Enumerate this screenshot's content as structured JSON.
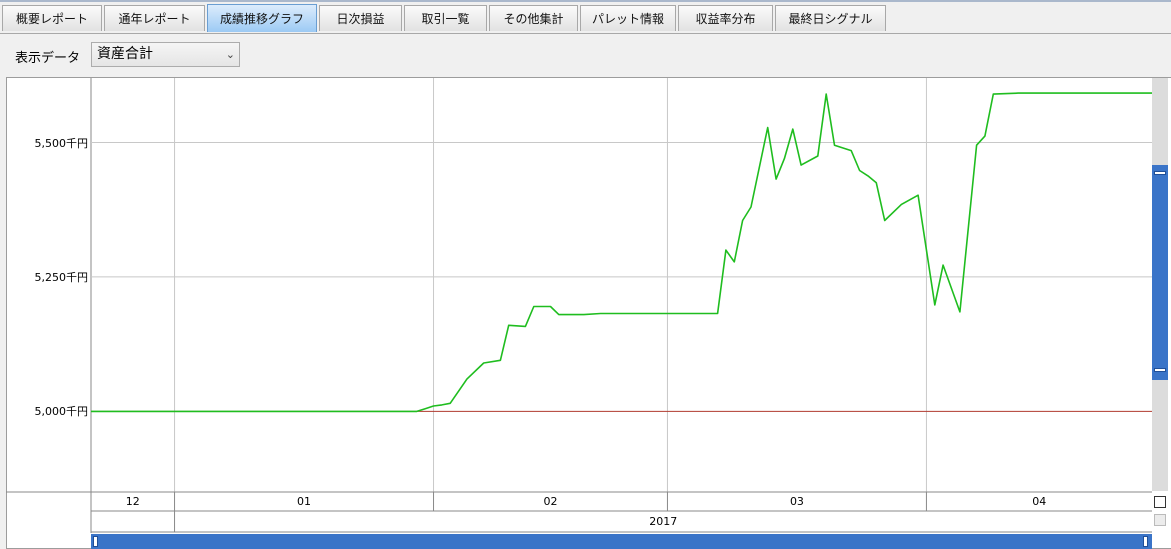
{
  "tabs": [
    {
      "label": "概要レポート"
    },
    {
      "label": "通年レポート"
    },
    {
      "label": "成績推移グラフ",
      "active": true
    },
    {
      "label": "日次損益"
    },
    {
      "label": "取引一覧"
    },
    {
      "label": "その他集計"
    },
    {
      "label": "パレット情報"
    },
    {
      "label": "収益率分布"
    },
    {
      "label": "最終日シグナル"
    }
  ],
  "selector": {
    "label": "表示データ",
    "value": "資産合計"
  },
  "colors": {
    "line": "#1fbd1f",
    "baseline": "#b03a2e",
    "accent": "#3a74c8"
  },
  "icons": [
    "chevron-down-icon"
  ],
  "chart_data": {
    "type": "line",
    "y_unit_suffix": "千円",
    "ylim": [
      4850,
      5620
    ],
    "yticks": [
      5000,
      5250,
      5500
    ],
    "ytick_labels": [
      "5,000千円",
      "5,250千円",
      "5,500千円"
    ],
    "xlim": [
      "2016-12-22",
      "2017-04-28"
    ],
    "month_labels": [
      {
        "label": "12",
        "start": "2016-12-22",
        "end": "2017-01-01"
      },
      {
        "label": "01",
        "start": "2017-01-01",
        "end": "2017-02-01"
      },
      {
        "label": "02",
        "start": "2017-02-01",
        "end": "2017-03-01"
      },
      {
        "label": "03",
        "start": "2017-03-01",
        "end": "2017-04-01"
      },
      {
        "label": "04",
        "start": "2017-04-01",
        "end": "2017-04-28"
      }
    ],
    "year_label": "2017",
    "baseline": 5000,
    "grid": true,
    "x": [
      "2016-12-22",
      "2017-01-30",
      "2017-01-31",
      "2017-02-01",
      "2017-02-02",
      "2017-02-03",
      "2017-02-05",
      "2017-02-07",
      "2017-02-09",
      "2017-02-10",
      "2017-02-12",
      "2017-02-13",
      "2017-02-15",
      "2017-02-16",
      "2017-02-17",
      "2017-02-19",
      "2017-02-21",
      "2017-02-28",
      "2017-03-07",
      "2017-03-08",
      "2017-03-09",
      "2017-03-10",
      "2017-03-11",
      "2017-03-13",
      "2017-03-14",
      "2017-03-15",
      "2017-03-16",
      "2017-03-17",
      "2017-03-19",
      "2017-03-20",
      "2017-03-21",
      "2017-03-23",
      "2017-03-24",
      "2017-03-25",
      "2017-03-26",
      "2017-03-27",
      "2017-03-29",
      "2017-03-31",
      "2017-04-02",
      "2017-04-03",
      "2017-04-05",
      "2017-04-07",
      "2017-04-08",
      "2017-04-09",
      "2017-04-12",
      "2017-04-14",
      "2017-04-15",
      "2017-04-17",
      "2017-04-18",
      "2017-04-20",
      "2017-04-22",
      "2017-04-23",
      "2017-04-24",
      "2017-04-25",
      "2017-04-26",
      "2017-04-28"
    ],
    "y": [
      5000,
      5000,
      5005,
      5010,
      5012,
      5015,
      5060,
      5090,
      5095,
      5160,
      5158,
      5195,
      5195,
      5180,
      5180,
      5180,
      5182,
      5182,
      5182,
      5300,
      5278,
      5355,
      5380,
      5528,
      5432,
      5470,
      5525,
      5458,
      5475,
      5590,
      5495,
      5485,
      5448,
      5438,
      5425,
      5355,
      5385,
      5402,
      5198,
      5272,
      5185,
      5495,
      5512,
      5590,
      5592,
      5592,
      5592,
      5592,
      5592,
      5592,
      5592,
      5592,
      5592,
      5592,
      5592,
      5592
    ]
  }
}
